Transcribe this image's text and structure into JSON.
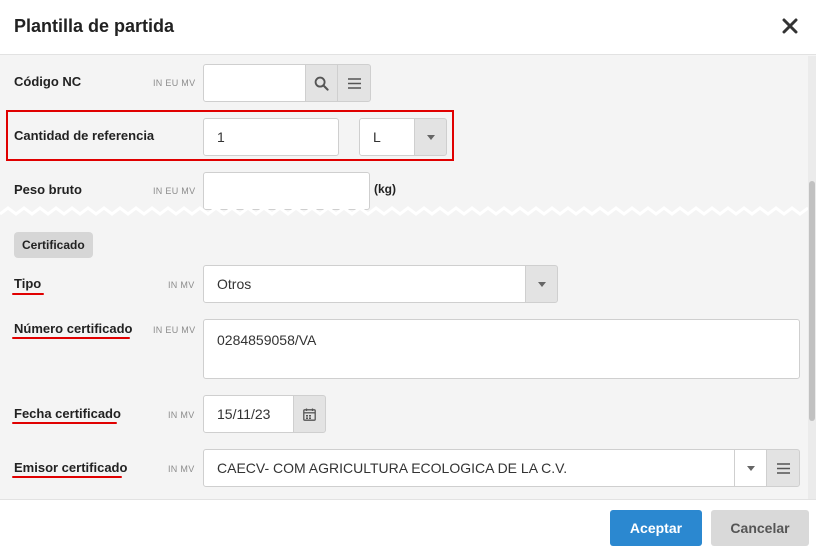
{
  "dialog": {
    "title": "Plantilla de partida",
    "close_icon": "close-icon"
  },
  "fields": {
    "codigo_nc": {
      "label": "Código NC",
      "tags": "IN EU MV",
      "value": ""
    },
    "cantidad_referencia": {
      "label": "Cantidad de referencia",
      "value": "1",
      "unit_selected": "L"
    },
    "peso_bruto": {
      "label": "Peso bruto",
      "tags": "IN EU MV",
      "value": "",
      "unit": "(kg)"
    },
    "certificado_section": "Certificado",
    "tipo": {
      "label": "Tipo",
      "tags": "IN MV",
      "value": "Otros"
    },
    "numero_certificado": {
      "label": "Número certificado",
      "tags": "IN EU MV",
      "value": "0284859058/VA"
    },
    "fecha_certificado": {
      "label": "Fecha certificado",
      "tags": "IN MV",
      "value": "15/11/23"
    },
    "emisor_certificado": {
      "label": "Emisor certificado",
      "tags": "IN MV",
      "value": "CAECV- COM AGRICULTURA ECOLOGICA DE LA C.V."
    }
  },
  "footer": {
    "accept_label": "Aceptar",
    "cancel_label": "Cancelar"
  },
  "colors": {
    "accent": "#2b88d0",
    "highlight": "#e00000"
  }
}
